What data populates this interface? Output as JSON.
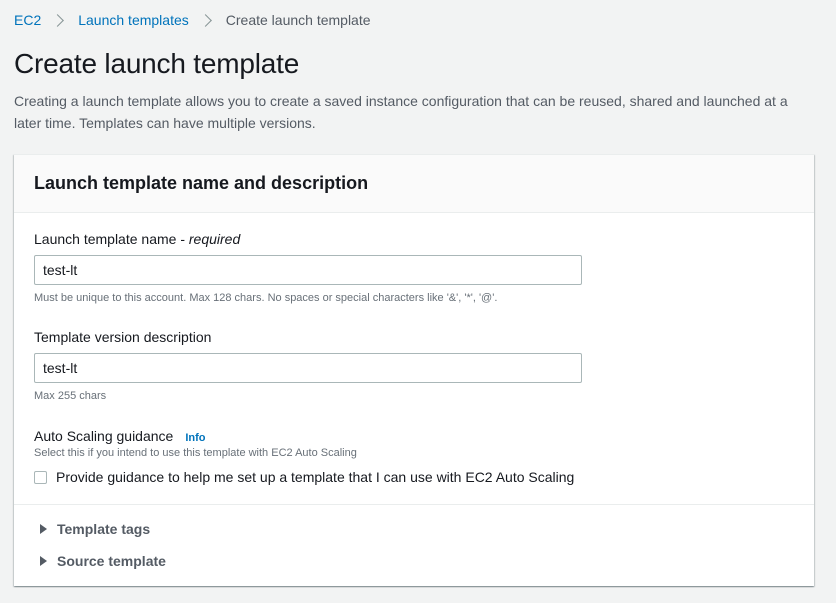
{
  "breadcrumb": {
    "items": [
      {
        "label": "EC2"
      },
      {
        "label": "Launch templates"
      }
    ],
    "current": "Create launch template"
  },
  "page": {
    "title": "Create launch template",
    "description": "Creating a launch template allows you to create a saved instance configuration that can be reused, shared and launched at a later time. Templates can have multiple versions."
  },
  "panel": {
    "title": "Launch template name and description",
    "name_field": {
      "label": "Launch template name - ",
      "label_required": "required",
      "value": "test-lt",
      "hint": "Must be unique to this account. Max 128 chars. No spaces or special characters like '&', '*', '@'."
    },
    "description_field": {
      "label": "Template version description",
      "value": "test-lt",
      "hint": "Max 255 chars"
    },
    "auto_scaling": {
      "label": "Auto Scaling guidance",
      "info": "Info",
      "hint": "Select this if you intend to use this template with EC2 Auto Scaling",
      "checkbox_label": "Provide guidance to help me set up a template that I can use with EC2 Auto Scaling",
      "checked": false
    },
    "expanders": [
      {
        "label": "Template tags"
      },
      {
        "label": "Source template"
      }
    ]
  },
  "colors": {
    "link": "#0073bb",
    "background": "#f2f3f3",
    "text": "#16191f",
    "secondary_text": "#545b64"
  }
}
